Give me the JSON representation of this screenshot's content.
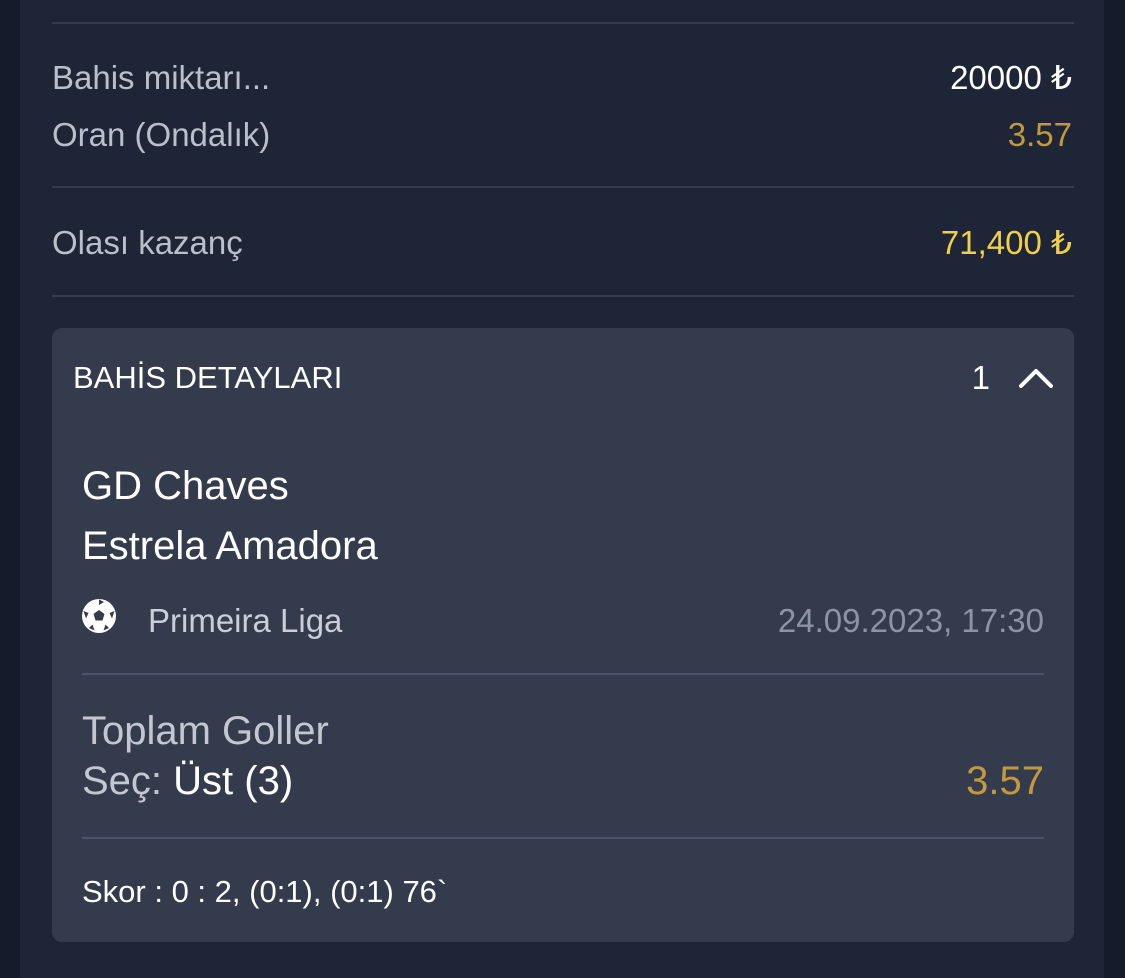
{
  "summary": {
    "stake_label": "Bahis miktarı...",
    "stake_value": "20000 ₺",
    "odds_label": "Oran (Ondalık)",
    "odds_value": "3.57",
    "payout_label": "Olası kazanç",
    "payout_value": "71,400 ₺"
  },
  "details": {
    "title": "BAHİS DETAYLARI",
    "count": "1",
    "toggle_icon": "chevron-up-icon",
    "event": {
      "home_team": "GD Chaves",
      "away_team": "Estrela Amadora",
      "sport_icon": "soccer-ball-icon",
      "league": "Primeira Liga",
      "datetime": "24.09.2023, 17:30"
    },
    "bet": {
      "market": "Toplam Goller",
      "selection_prefix": "Seç: ",
      "selection_value": "Üst (3)",
      "odds": "3.57"
    },
    "score": "Skor : 0 : 2, (0:1), (0:1) 76`"
  },
  "colors": {
    "background": "#141c2c",
    "panel": "#1e2536",
    "card": "#343b4d",
    "odds_accent": "#c19a3f",
    "payout_accent": "#f2cf4a",
    "text_primary": "#ffffff",
    "text_secondary": "#b9bfcb"
  }
}
